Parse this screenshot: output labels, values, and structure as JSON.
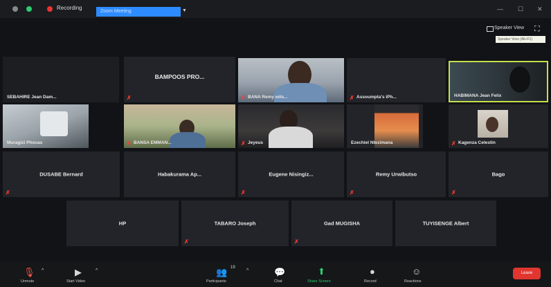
{
  "topbar": {
    "recording_label": "Recording",
    "meeting_title": "Zoom Meeting",
    "speaker_view_label": "Speaker View",
    "speaker_view_tooltip": "Speaker View (Alt+F1)"
  },
  "participants": [
    {
      "name": "SEBAHIRE Jean Dam...",
      "muted": false,
      "video": false
    },
    {
      "name": "BAMPOOS PRO...",
      "muted": true,
      "video": false
    },
    {
      "name": "BANA Remy wils...",
      "muted": true,
      "video": true
    },
    {
      "name": "Assoumpta's iPh...",
      "muted": true,
      "video": false
    },
    {
      "name": "HABIMANA Jean Felix",
      "muted": false,
      "video": true,
      "active_speaker": true
    },
    {
      "name": "Muragizi Phocas",
      "muted": false,
      "video": true
    },
    {
      "name": "BANSA EMMAN...",
      "muted": true,
      "video": true
    },
    {
      "name": "Jeyeus",
      "muted": true,
      "video": true
    },
    {
      "name": "Ezechiel Ntezimana",
      "muted": false,
      "video": true
    },
    {
      "name": "Kagenza Celestin",
      "muted": true,
      "video": true
    },
    {
      "name": "DUSABE Bernard",
      "muted": true,
      "video": false
    },
    {
      "name": "Habakurama Ap...",
      "muted": false,
      "video": false
    },
    {
      "name": "Eugene Nisingiz...",
      "muted": true,
      "video": false
    },
    {
      "name": "Remy Urwibutso",
      "muted": true,
      "video": false
    },
    {
      "name": "Bago",
      "muted": true,
      "video": false
    },
    {
      "name": "HP",
      "muted": false,
      "video": false
    },
    {
      "name": "TABARO Joseph",
      "muted": true,
      "video": false
    },
    {
      "name": "Gad MUGISHA",
      "muted": true,
      "video": false
    },
    {
      "name": "TUYISENGE Albert",
      "muted": false,
      "video": false
    }
  ],
  "toolbar": {
    "unmute_label": "Unmute",
    "start_video_label": "Start Video",
    "participants_label": "Participants",
    "participants_count": "19",
    "chat_label": "Chat",
    "share_screen_label": "Share Screen",
    "record_label": "Record",
    "reactions_label": "Reactions",
    "end_label": "Leave"
  },
  "colors": {
    "active_speaker_border": "#c8e04a",
    "muted_icon": "#ff3b30",
    "end_button": "#e0362f",
    "share_screen": "#2ecc71",
    "recording_dot": "#e33"
  }
}
